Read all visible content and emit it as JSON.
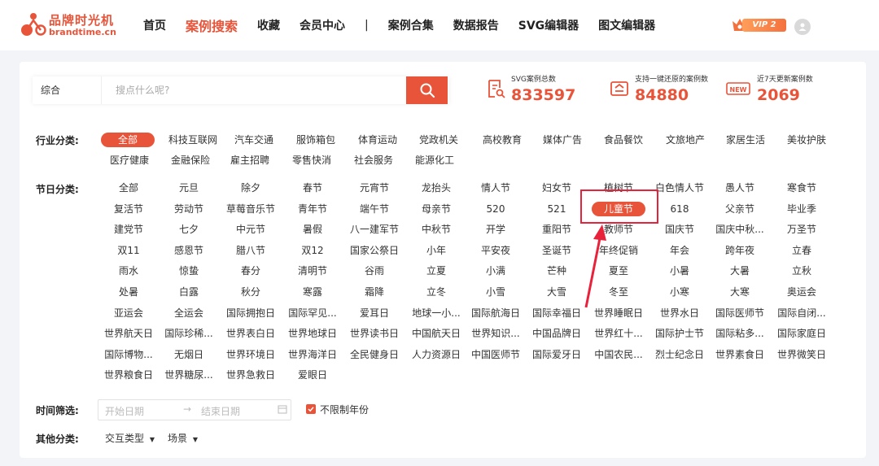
{
  "brand": {
    "name_cn": "品牌时光机",
    "name_en": "brandtime.cn"
  },
  "nav": [
    "首页",
    "案例搜索",
    "收藏",
    "会员中心",
    "|",
    "案例合集",
    "数据报告",
    "SVG编辑器",
    "图文编辑器"
  ],
  "nav_active": "案例搜索",
  "vip_label": "VIP 2",
  "search": {
    "category": "综合",
    "placeholder": "搜点什么呢?"
  },
  "stats": [
    {
      "label": "SVG案例总数",
      "value": "833597",
      "icon": "document-search-icon"
    },
    {
      "label": "支持一键还原的案例数",
      "value": "84880",
      "icon": "restore-icon"
    },
    {
      "label": "近7天更新案例数",
      "value": "2069",
      "icon": "new-badge-icon"
    }
  ],
  "industry": {
    "label": "行业分类:",
    "items": [
      "全部",
      "科技互联网",
      "汽车交通",
      "服饰箱包",
      "体育运动",
      "党政机关",
      "高校教育",
      "媒体广告",
      "食品餐饮",
      "文旅地产",
      "家居生活",
      "美妆护肤",
      "医疗健康",
      "金融保险",
      "雇主招聘",
      "零售快消",
      "社会服务",
      "能源化工"
    ],
    "selected": "全部"
  },
  "festival": {
    "label": "节日分类:",
    "items": [
      "全部",
      "元旦",
      "除夕",
      "春节",
      "元宵节",
      "龙抬头",
      "情人节",
      "妇女节",
      "植树节",
      "白色情人节",
      "愚人节",
      "寒食节",
      "复活节",
      "劳动节",
      "草莓音乐节",
      "青年节",
      "端午节",
      "母亲节",
      "520",
      "521",
      "儿童节",
      "618",
      "父亲节",
      "毕业季",
      "建党节",
      "七夕",
      "中元节",
      "暑假",
      "八一建军节",
      "中秋节",
      "开学",
      "重阳节",
      "教师节",
      "国庆节",
      "国庆中秋...",
      "万圣节",
      "双11",
      "感恩节",
      "腊八节",
      "双12",
      "国家公祭日",
      "小年",
      "平安夜",
      "圣诞节",
      "年终促销",
      "年会",
      "跨年夜",
      "立春",
      "雨水",
      "惊蛰",
      "春分",
      "清明节",
      "谷雨",
      "立夏",
      "小满",
      "芒种",
      "夏至",
      "小暑",
      "大暑",
      "立秋",
      "处暑",
      "白露",
      "秋分",
      "寒露",
      "霜降",
      "立冬",
      "小雪",
      "大雪",
      "冬至",
      "小寒",
      "大寒",
      "奥运会",
      "亚运会",
      "全运会",
      "国际拥抱日",
      "国际罕见...",
      "爱耳日",
      "地球一小...",
      "国际航海日",
      "国际幸福日",
      "世界睡眠日",
      "世界水日",
      "国际医师节",
      "国际自闭...",
      "世界航天日",
      "国际珍稀...",
      "世界表白日",
      "世界地球日",
      "世界读书日",
      "中国航天日",
      "世界知识...",
      "中国品牌日",
      "世界红十...",
      "国际护士节",
      "国际粘多...",
      "国际家庭日",
      "国际博物...",
      "无烟日",
      "世界环境日",
      "世界海洋日",
      "全民健身日",
      "人力资源日",
      "中国医师节",
      "国际爱牙日",
      "中国农民...",
      "烈士纪念日",
      "世界素食日",
      "世界微笑日",
      "世界粮食日",
      "世界糖尿...",
      "世界急救日",
      "爱眼日"
    ],
    "selected": "儿童节"
  },
  "time": {
    "label": "时间筛选:",
    "start_placeholder": "开始日期",
    "end_placeholder": "结束日期",
    "no_limit": "不限制年份"
  },
  "other": {
    "label": "其他分类:",
    "dropdowns": [
      "交互类型",
      "场景"
    ]
  },
  "colors": {
    "accent": "#e8543a",
    "annotation": "#e8223a"
  }
}
